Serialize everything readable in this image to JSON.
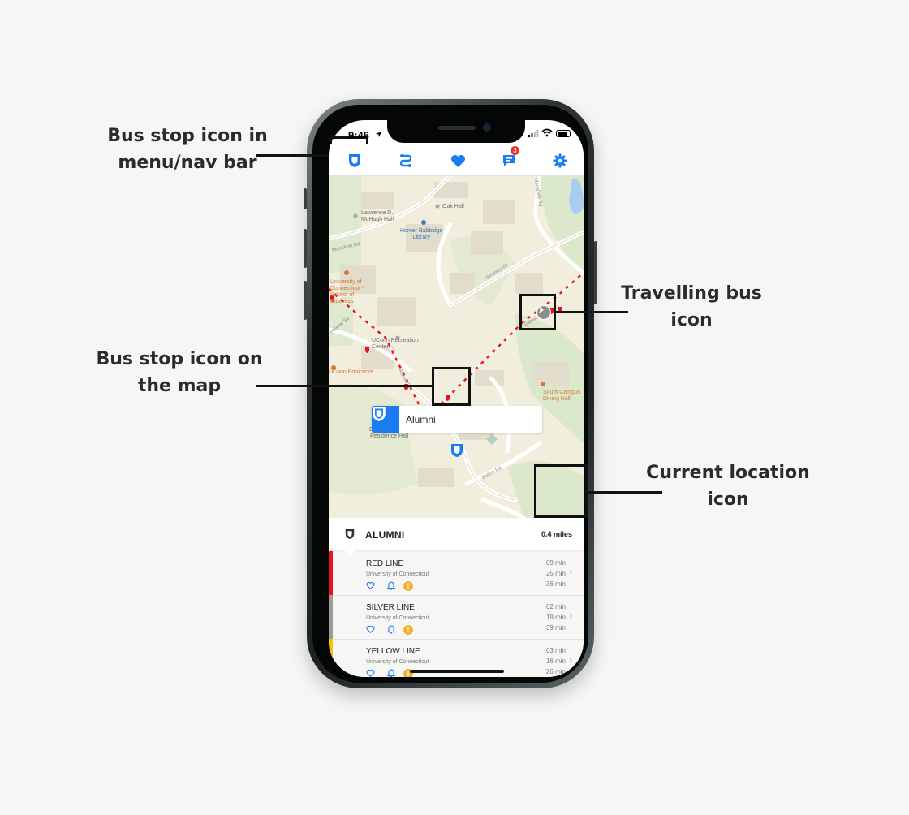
{
  "annotations": {
    "nav_stop": "Bus stop icon in\nmenu/nav bar",
    "map_stop": "Bus stop icon on\nthe map",
    "bus": "Travelling bus\nicon",
    "location": "Current location\nicon"
  },
  "status": {
    "time": "9:46"
  },
  "nav": {
    "messages_badge": "3"
  },
  "map": {
    "places": [
      {
        "text": "Oak Hall"
      },
      {
        "text": "Lawrence D.\nMcHugh Hall"
      },
      {
        "text": "Homer Babbidge\nLibrary"
      },
      {
        "text": "University of\nConnecticut -\nSchool of\nBusiness"
      },
      {
        "text": "UConn Recreation\nCenter"
      },
      {
        "text": "UConn Bookstore"
      },
      {
        "text": "Brien McMahon\nResidence Hall"
      },
      {
        "text": "South Campus\nDining Hall"
      }
    ],
    "roads": [
      "Mansfield Rd",
      "Mansfield Rd",
      "Whitney Rd",
      "Bolton Rd",
      "Hillside Rd",
      "Gilbert Rd",
      "Alumni Dr"
    ],
    "callout_name": "Alumni"
  },
  "panel": {
    "stop_name": "ALUMNI",
    "distance": "0.4 miles",
    "routes": [
      {
        "name": "RED LINE",
        "sub": "University of Connecticut",
        "times": [
          "09 min",
          "25 min",
          "36 min"
        ],
        "color": "#e8141b"
      },
      {
        "name": "SILVER LINE",
        "sub": "University of Connecticut",
        "times": [
          "02 min",
          "19 min",
          "39 min"
        ],
        "color": "#9b9b9b"
      },
      {
        "name": "YELLOW LINE",
        "sub": "University of Connecticut",
        "times": [
          "03 min",
          "16 min",
          "26 min"
        ],
        "color": "#f3c400"
      }
    ]
  },
  "colors": {
    "accent": "#1b7cf2",
    "badge": "#e0342e",
    "warning": "#f1b230"
  },
  "icons": {
    "nav": [
      "bus-stop-shield-icon",
      "routes-icon",
      "favorites-heart-icon",
      "messages-icon",
      "settings-gear-icon"
    ],
    "map": [
      "bus-stop-shield-icon",
      "travelling-bus-icon",
      "current-location-arrow-icon"
    ]
  }
}
